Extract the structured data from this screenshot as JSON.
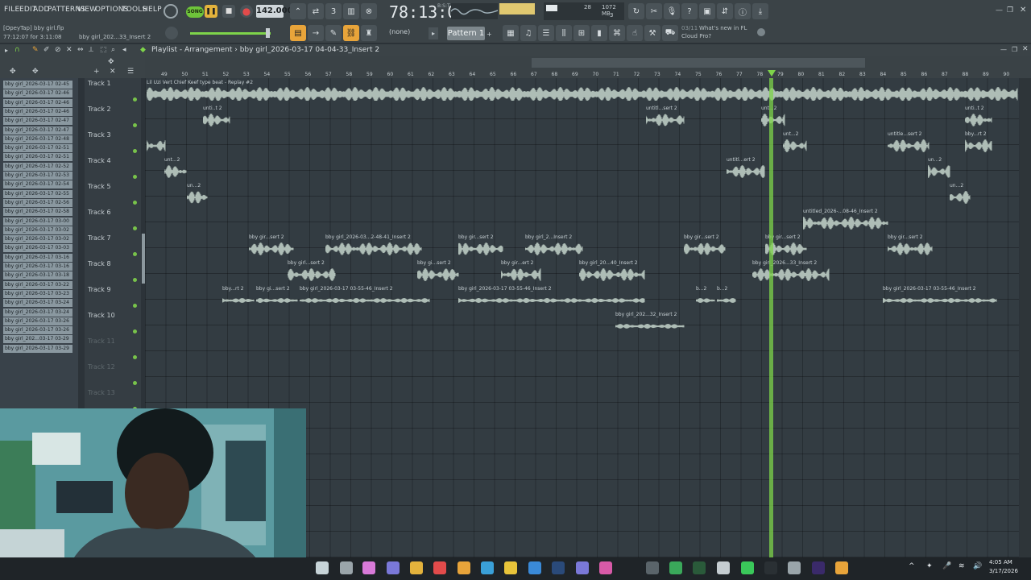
{
  "menu": [
    "FILE",
    "EDIT",
    "ADD",
    "PATTERNS",
    "VIEW",
    "OPTIONS",
    "TOOLS",
    "HELP"
  ],
  "transport": {
    "mode": "SONG",
    "tempo": "142.000",
    "time": "78:13:06",
    "time_unit": "B:S:T"
  },
  "cpu": {
    "value": "28",
    "memory": "1072 MB",
    "polyphony": "3"
  },
  "hint": {
    "line1": "[OpeyTap] bby girl.flp",
    "line2": "77:12:07 for 3:11:08",
    "name": "bby girl_202...33_Insert 2"
  },
  "pattern": {
    "label": "Pattern 1",
    "none_label": "(none)"
  },
  "news": {
    "date": "03/11",
    "title": "What's new in FL",
    "line2": "Cloud Pro?"
  },
  "playlist": {
    "label": "Playlist - Arrangement",
    "path": "bby girl_2026-03-17 04-04-33_Insert 2"
  },
  "ruler": [
    "49",
    "50",
    "51",
    "52",
    "53",
    "54",
    "55",
    "56",
    "57",
    "58",
    "59",
    "60",
    "61",
    "62",
    "63",
    "64",
    "65",
    "66",
    "67",
    "68",
    "69",
    "70",
    "71",
    "72",
    "73",
    "74",
    "75",
    "76",
    "77",
    "78",
    "79",
    "80",
    "81",
    "82",
    "83",
    "84",
    "85",
    "86",
    "87",
    "88",
    "89",
    "90"
  ],
  "channels": [
    "bby girl_2026-03-17 02-45",
    "bby girl_2026-03-17 02-46",
    "bby girl_2026-03-17 02-46",
    "bby girl_2026-03-17 02-46",
    "bby girl_2026-03-17 02-47",
    "bby girl_2026-03-17 02-47",
    "bby girl_2026-03-17 02-48",
    "bby girl_2026-03-17 02-51",
    "bby girl_2026-03-17 02-51",
    "bby girl_2026-03-17 02-52",
    "bby girl_2026-03-17 02-53",
    "bby girl_2026-03-17 02-54",
    "bby girl_2026-03-17 02-55",
    "bby girl_2026-03-17 02-56",
    "bby girl_2026-03-17 02-58",
    "bby girl_2026-03-17 03-00",
    "bby girl_2026-03-17 03-02",
    "bby girl_2026-03-17 03-02",
    "bby girl_2026-03-17 03-03",
    "bby girl_2026-03-17 03-16",
    "bby girl_2026-03-17 03-16",
    "bby girl_2026-03-17 03-18",
    "bby girl_2026-03-17 03-22",
    "bby girl_2026-03-17 03-23",
    "bby girl_2026-03-17 03-24",
    "bby girl_2026-03-17 03-24",
    "bby girl_2026-03-17 03-26",
    "bby girl_2026-03-17 03-26",
    "bby girl_202...03-17 03-29",
    "bby girl_2026-03-17 03-29"
  ],
  "tracks": [
    "Track 1",
    "Track 2",
    "Track 3",
    "Track 4",
    "Track 5",
    "Track 6",
    "Track 7",
    "Track 8",
    "Track 9",
    "Track 10",
    "Track 11",
    "Track 12",
    "Track 13"
  ],
  "clips": [
    {
      "track": 0,
      "start": 0,
      "len": 1085,
      "label": "Lil Uzi Vert  Chief Keef type beat - Replay #2",
      "color": "#aebdb6"
    },
    {
      "track": 1,
      "start": 70,
      "len": 34,
      "label": "unti..t 2",
      "color": "#aebdb6"
    },
    {
      "track": 1,
      "start": 620,
      "len": 48,
      "label": "untitl...sert 2",
      "color": "#aebdb6"
    },
    {
      "track": 1,
      "start": 763,
      "len": 30,
      "label": "unt...2",
      "color": "#aebdb6"
    },
    {
      "track": 1,
      "start": 1016,
      "len": 34,
      "label": "unti..t 2",
      "color": "#aebdb6"
    },
    {
      "track": 2,
      "start": 0,
      "len": 24,
      "label": "",
      "color": "#aebdb6"
    },
    {
      "track": 2,
      "start": 790,
      "len": 30,
      "label": "unt...2",
      "color": "#aebdb6"
    },
    {
      "track": 2,
      "start": 920,
      "len": 52,
      "label": "untitle...sert 2",
      "color": "#aebdb6"
    },
    {
      "track": 2,
      "start": 1016,
      "len": 34,
      "label": "bby...rt 2",
      "color": "#aebdb6"
    },
    {
      "track": 3,
      "start": 22,
      "len": 28,
      "label": "unt...2",
      "color": "#aebdb6"
    },
    {
      "track": 3,
      "start": 720,
      "len": 48,
      "label": "untitl...ert 2",
      "color": "#aebdb6"
    },
    {
      "track": 3,
      "start": 970,
      "len": 28,
      "label": "un...2",
      "color": "#aebdb6"
    },
    {
      "track": 4,
      "start": 50,
      "len": 26,
      "label": "un...2",
      "color": "#aebdb6"
    },
    {
      "track": 4,
      "start": 997,
      "len": 26,
      "label": "un...2",
      "color": "#aebdb6"
    },
    {
      "track": 5,
      "start": 815,
      "len": 106,
      "label": "untitled_2026-...08-46_Insert 2",
      "color": "#aebdb6"
    },
    {
      "track": 6,
      "start": 127,
      "len": 56,
      "label": "bby gir...sert 2",
      "color": "#aebdb6"
    },
    {
      "track": 6,
      "start": 222,
      "len": 120,
      "label": "bby girl_2026-03...2-48-41_Insert 2",
      "color": "#aebdb6"
    },
    {
      "track": 6,
      "start": 387,
      "len": 56,
      "label": "bby gir...sert 2",
      "color": "#aebdb6"
    },
    {
      "track": 6,
      "start": 470,
      "len": 72,
      "label": "bby girl_2...Insert 2",
      "color": "#aebdb6"
    },
    {
      "track": 6,
      "start": 667,
      "len": 52,
      "label": "bby gir...sert 2",
      "color": "#aebdb6"
    },
    {
      "track": 6,
      "start": 768,
      "len": 52,
      "label": "bby gir...sert 2",
      "color": "#aebdb6"
    },
    {
      "track": 6,
      "start": 920,
      "len": 56,
      "label": "bby gir...sert 2",
      "color": "#aebdb6"
    },
    {
      "track": 7,
      "start": 175,
      "len": 60,
      "label": "bby girl...sert 2",
      "color": "#aebdb6"
    },
    {
      "track": 7,
      "start": 336,
      "len": 52,
      "label": "bby gi...sert 2",
      "color": "#aebdb6"
    },
    {
      "track": 7,
      "start": 440,
      "len": 50,
      "label": "bby gir...ert 2",
      "color": "#aebdb6"
    },
    {
      "track": 7,
      "start": 537,
      "len": 82,
      "label": "bby girl_20...40_Insert 2",
      "color": "#aebdb6"
    },
    {
      "track": 7,
      "start": 752,
      "len": 96,
      "label": "bby girl_2026...33_Insert 2",
      "color": "#aebdb6"
    },
    {
      "track": 8,
      "start": 94,
      "len": 40,
      "label": "bby...rt 2",
      "color": "#aebdb6"
    },
    {
      "track": 8,
      "start": 136,
      "len": 52,
      "label": "bby gi...sert 2",
      "color": "#aebdb6"
    },
    {
      "track": 8,
      "start": 190,
      "len": 162,
      "label": "bby girl_2026-03-17 03-55-46_Insert 2",
      "color": "#aebdb6"
    },
    {
      "track": 8,
      "start": 387,
      "len": 232,
      "label": "bby girl_2026-03-17 03-55-46_Insert 2",
      "color": "#aebdb6"
    },
    {
      "track": 8,
      "start": 682,
      "len": 24,
      "label": "b...2",
      "color": "#aebdb6"
    },
    {
      "track": 8,
      "start": 708,
      "len": 24,
      "label": "b...2",
      "color": "#aebdb6"
    },
    {
      "track": 8,
      "start": 914,
      "len": 142,
      "label": "bby girl_2026-03-17 03-55-46_Insert 2",
      "color": "#aebdb6"
    },
    {
      "track": 9,
      "start": 582,
      "len": 86,
      "label": "bby girl_202...32_Insert 2",
      "color": "#aebdb6"
    }
  ],
  "taskbar": {
    "time": "4:05 AM",
    "date": "3/17/2026"
  }
}
